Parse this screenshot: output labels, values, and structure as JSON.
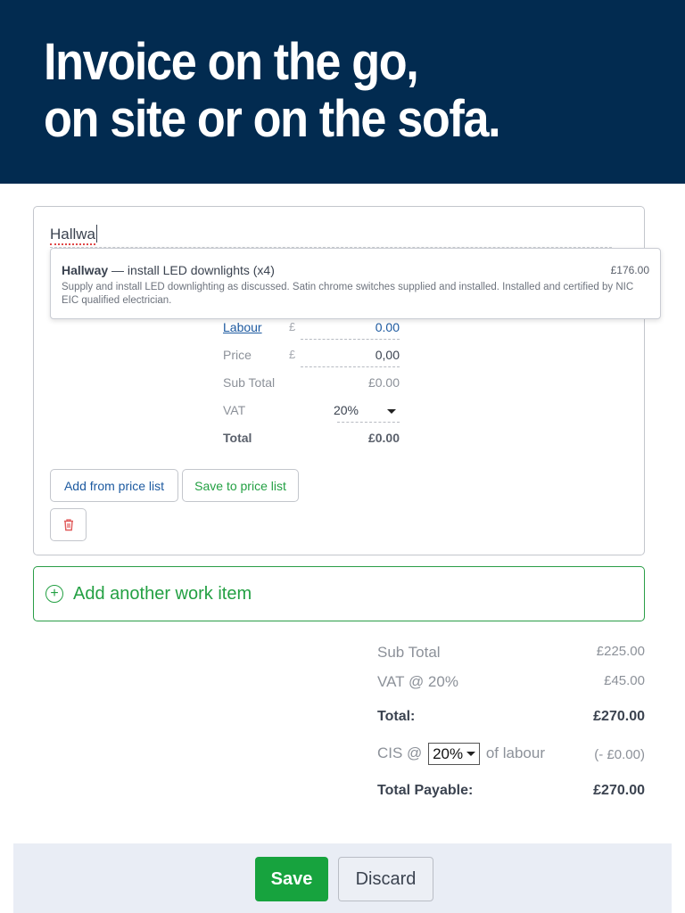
{
  "hero": {
    "line1": "Invoice on the go,",
    "line2": "on site or on the sofa.",
    "bg_color": "#022b50"
  },
  "work_item": {
    "description_value": "Hallwa",
    "suggestion": {
      "title_bold": "Hallway",
      "title_rest": " — install LED downlights (x4)",
      "price": "£176.00",
      "body": "Supply and install LED downlighting as discussed. Satin chrome switches supplied and installed. Installed and certified by NIC EIC qualified electrician."
    },
    "fields": {
      "labour": {
        "label": "Labour",
        "currency": "£",
        "value": "0.00"
      },
      "price": {
        "label": "Price",
        "currency": "£",
        "value": "0,00"
      },
      "subtotal": {
        "label": "Sub Total",
        "value": "£0.00"
      },
      "vat": {
        "label": "VAT",
        "value": "20%"
      },
      "total": {
        "label": "Total",
        "value": "£0.00"
      }
    },
    "buttons": {
      "add_from_price_list": "Add from price list",
      "save_to_price_list": "Save to price list",
      "delete_icon": "trash-icon"
    }
  },
  "add_another": {
    "label": "Add another work item",
    "icon": "plus-circle-icon"
  },
  "totals": {
    "subtotal": {
      "label": "Sub Total",
      "value": "£225.00"
    },
    "vat": {
      "label": "VAT @ 20%",
      "value": "£45.00"
    },
    "total": {
      "label": "Total:",
      "value": "£270.00"
    },
    "cis": {
      "prefix": "CIS @",
      "selected": "20%",
      "suffix": "of labour",
      "value": "(- £0.00)"
    },
    "total_payable": {
      "label": "Total Payable:",
      "value": "£270.00"
    }
  },
  "footer": {
    "save": "Save",
    "discard": "Discard",
    "save_color": "#17a33e"
  }
}
